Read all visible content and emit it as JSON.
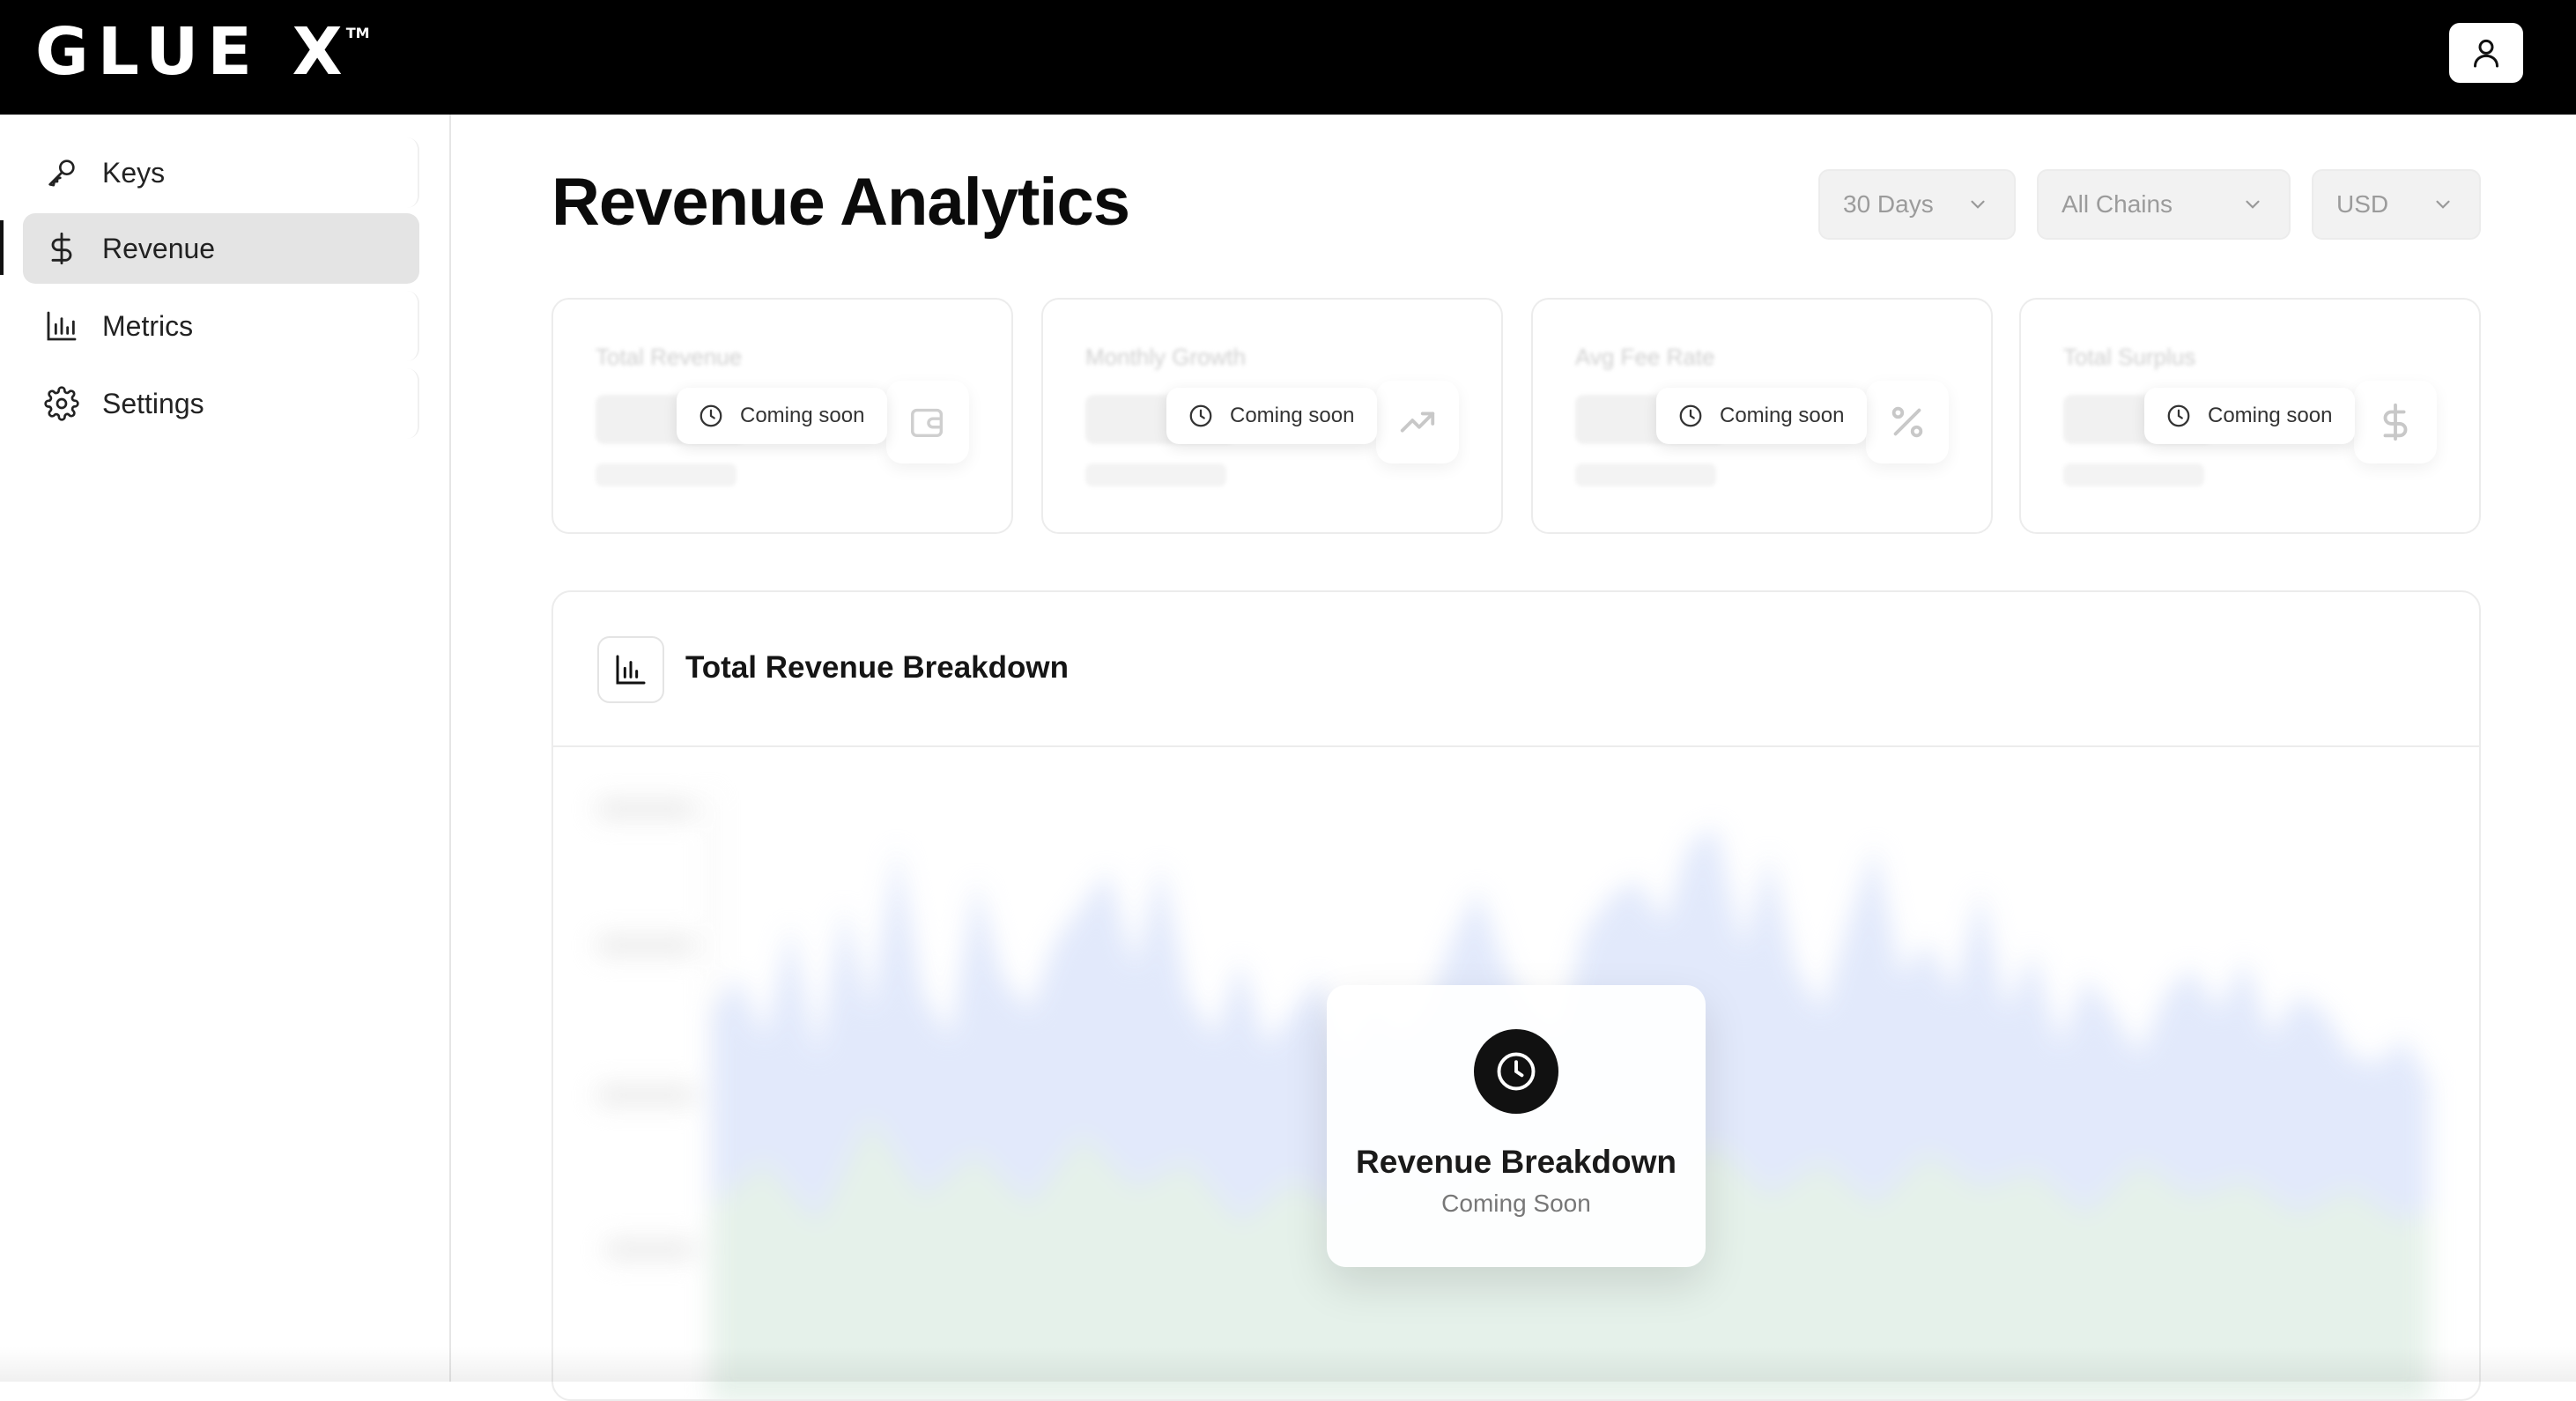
{
  "app": {
    "logo_text": "GLUE X",
    "logo_tm": "TM"
  },
  "header": {
    "user_icon": "user-icon"
  },
  "sidebar": {
    "items": [
      {
        "label": "Keys",
        "icon": "key-icon",
        "active": false
      },
      {
        "label": "Revenue",
        "icon": "dollar-icon",
        "active": true
      },
      {
        "label": "Metrics",
        "icon": "bar-chart-icon",
        "active": false
      },
      {
        "label": "Settings",
        "icon": "gear-icon",
        "active": false
      }
    ]
  },
  "main": {
    "title": "Revenue Analytics",
    "filters": {
      "period": "30 Days",
      "chain": "All Chains",
      "currency": "USD"
    },
    "stats": [
      {
        "label": "Total Revenue",
        "status": "Coming soon",
        "icon": "wallet-icon"
      },
      {
        "label": "Monthly Growth",
        "status": "Coming soon",
        "icon": "trending-up-icon"
      },
      {
        "label": "Avg Fee Rate",
        "status": "Coming soon",
        "icon": "percent-icon"
      },
      {
        "label": "Total Surplus",
        "status": "Coming soon",
        "icon": "dollar-icon"
      }
    ],
    "breakdown": {
      "title": "Total Revenue Breakdown",
      "overlay_title": "Revenue Breakdown",
      "overlay_subtitle": "Coming Soon"
    }
  },
  "colors": {
    "topbar": "#000000",
    "active_nav": "#e4e4e4",
    "chart_blue": "#dfe7fb",
    "chart_green": "#e3f1e6"
  }
}
